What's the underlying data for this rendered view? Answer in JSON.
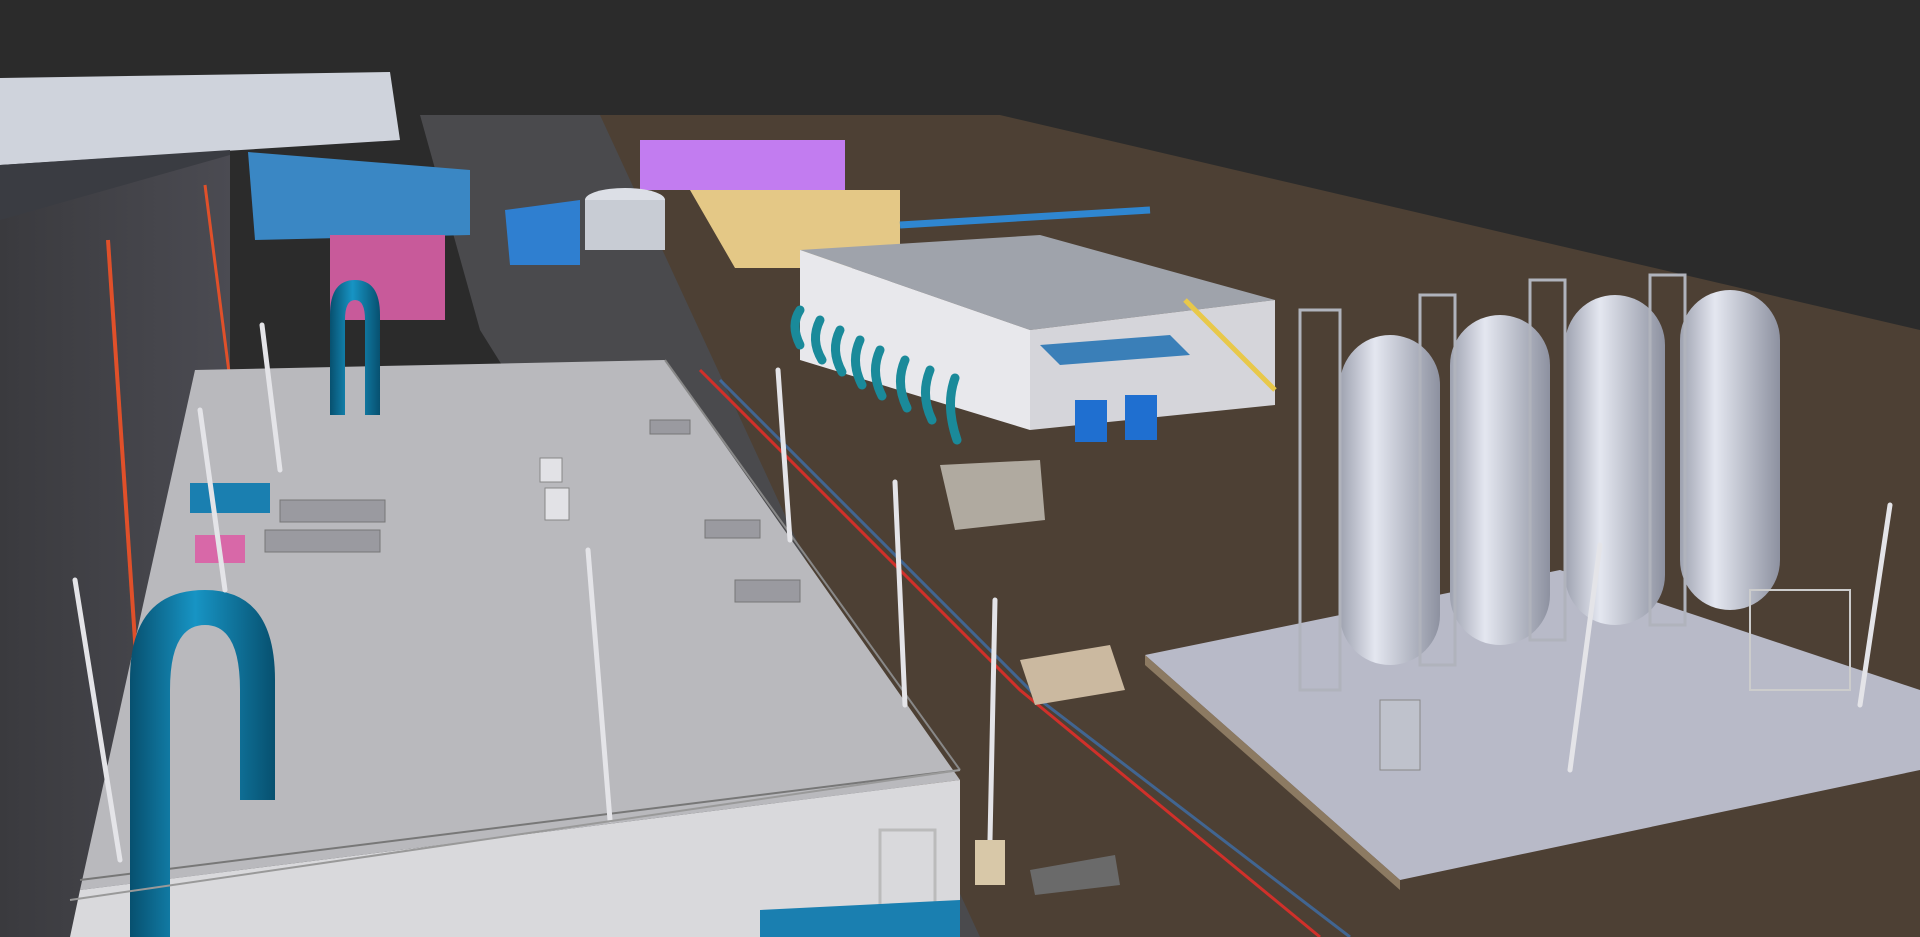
{
  "scene": {
    "type": "3d-plant-model-viewport",
    "background": "#2b2b2b",
    "ground": "#5a4a3a",
    "concrete": "#bcbcc4",
    "pipe_blue": "#0d6e9a",
    "pipe_teal": "#1a8a9a",
    "pipe_red": "#d0302a",
    "accent_yellow": "#e8c84a",
    "accent_purple": "#c27cf0",
    "accent_pink": "#d868a8",
    "tank_silver": "#c8ccd8"
  },
  "objects": {
    "main_building": "roof-slab",
    "storage_tanks": 4,
    "light_poles": 9
  }
}
